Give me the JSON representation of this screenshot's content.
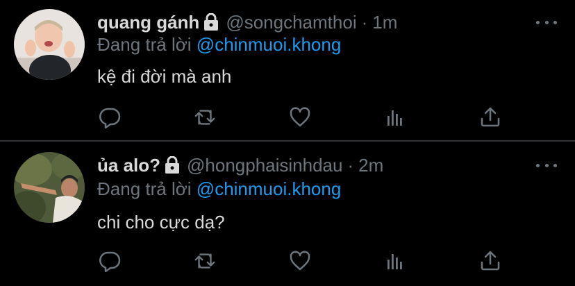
{
  "tweets": [
    {
      "name": "quang gánh",
      "handle": "@songchamthoi",
      "separator": "·",
      "time": "1m",
      "reply_prefix": "Đang trả lời",
      "reply_to": "@chinmuoi.khong",
      "text": "kệ đi đời mà anh",
      "avatar_icon": "user-avatar-photo",
      "protected_icon": "lock-icon"
    },
    {
      "name": "ủa alo?",
      "handle": "@hongphaisinhdau",
      "separator": "·",
      "time": "2m",
      "reply_prefix": "Đang trả lời",
      "reply_to": "@chinmuoi.khong",
      "text": "chi cho cực dạ?",
      "avatar_icon": "user-avatar-photo",
      "protected_icon": "lock-icon"
    }
  ],
  "actions": [
    "reply-icon",
    "retweet-icon",
    "like-icon",
    "analytics-icon",
    "share-icon"
  ],
  "colors": {
    "background": "#000000",
    "text": "#d9d9d9",
    "secondary": "#6e767d",
    "link": "#1d9bf0",
    "divider": "#2f3336"
  }
}
